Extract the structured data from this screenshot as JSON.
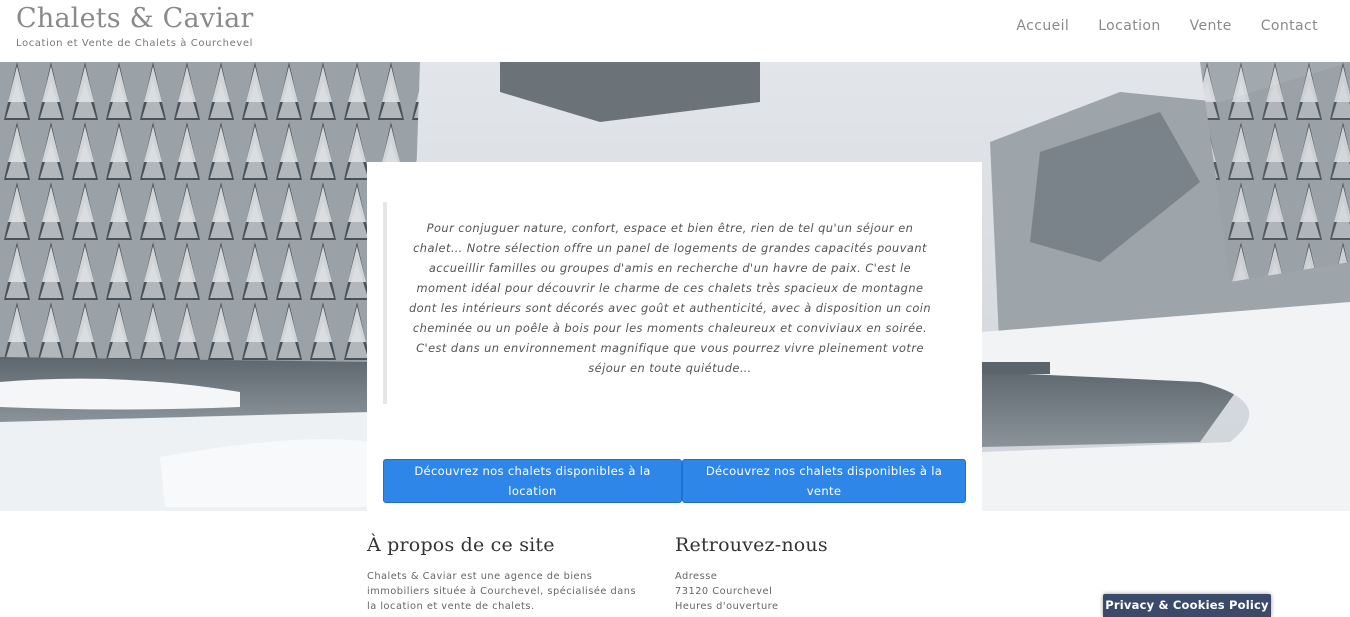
{
  "header": {
    "title": "Chalets & Caviar",
    "tagline": "Location et Vente de Chalets à Courchevel",
    "nav": [
      "Accueil",
      "Location",
      "Vente",
      "Contact"
    ]
  },
  "hero": {
    "quote": "Pour conjuguer nature, confort, espace et bien être, rien de tel qu'un séjour en chalet… Notre sélection offre un panel de logements de grandes capacités pouvant accueillir familles ou groupes d'amis en recherche d'un havre de paix. C'est le moment idéal pour découvrir le charme de ces chalets très spacieux de montagne dont les intérieurs sont décorés avec goût et authenticité, avec à disposition un coin cheminée ou un poêle à bois pour les moments chaleureux et conviviaux en soirée. C'est dans un environnement magnifique que vous pourrez vivre pleinement votre séjour en toute quiétude…",
    "btn_location": "Découvrez nos chalets disponibles à la location",
    "btn_vente": "Découvrez nos chalets disponibles à la vente"
  },
  "about": {
    "heading": "À propos de ce site",
    "lines": [
      "Chalets & Caviar est une agence de biens",
      "immobiliers située à Courchevel, spécialisée dans",
      "la location et vente de chalets."
    ]
  },
  "contact": {
    "heading": "Retrouvez-nous",
    "lines": [
      "Adresse",
      "73120 Courchevel",
      "Heures d'ouverture"
    ]
  },
  "privacy_label": "Privacy & Cookies Policy",
  "colors": {
    "button": "#2e86e8",
    "privacy_bg": "#3b4a6b"
  }
}
